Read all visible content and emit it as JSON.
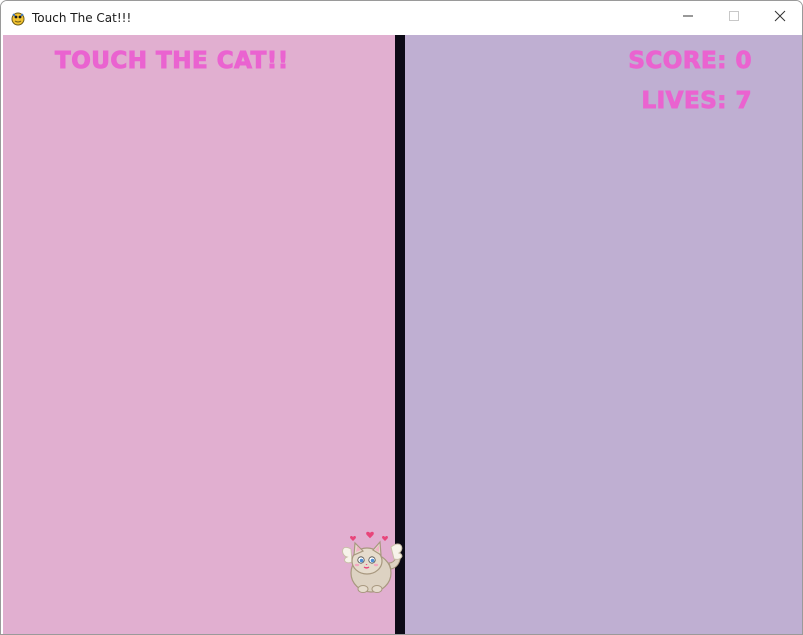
{
  "window": {
    "title": "Touch The Cat!!!",
    "app_icon": "pygame-snake-icon",
    "controls": {
      "minimize": "minimize-icon",
      "maximize": "maximize-icon",
      "close": "close-icon"
    }
  },
  "game": {
    "title": "TOUCH THE CAT!!",
    "score_label": "SCORE:",
    "score_value": 0,
    "lives_label": "LIVES:",
    "lives_value": 7,
    "cat_sprite": "winged-cat-with-hearts-icon"
  },
  "colors": {
    "left_panel": "#e1afd0",
    "right_panel": "#bfafd2",
    "divider": "#0c0a16",
    "hud_text": "#ea63d0"
  }
}
